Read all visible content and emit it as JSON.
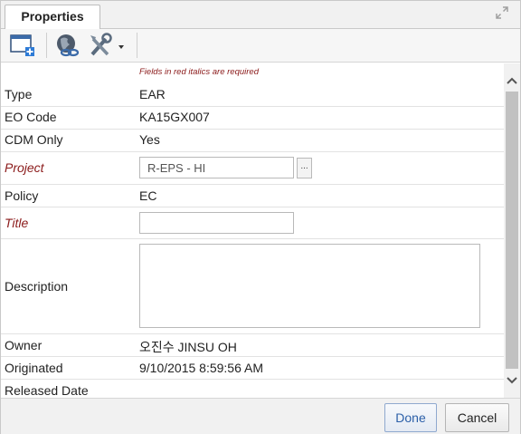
{
  "tab": {
    "label": "Properties"
  },
  "toolbar": {
    "buttons": [
      {
        "icon": "new-window-icon"
      },
      {
        "icon": "globe-link-icon"
      },
      {
        "icon": "tools-icon"
      }
    ]
  },
  "form": {
    "required_note": "Fields in red italics are required",
    "fields": {
      "type": {
        "label": "Type",
        "value": "EAR"
      },
      "eo_code": {
        "label": "EO Code",
        "value": "KA15GX007"
      },
      "cdm_only": {
        "label": "CDM Only",
        "value": "Yes"
      },
      "project": {
        "label": "Project",
        "value": "R-EPS - HI",
        "browse": "..."
      },
      "policy": {
        "label": "Policy",
        "value": "EC"
      },
      "title": {
        "label": "Title",
        "value": ""
      },
      "description": {
        "label": "Description",
        "value": ""
      },
      "owner": {
        "label": "Owner",
        "value": "오진수 JINSU OH"
      },
      "originated": {
        "label": "Originated",
        "value": "9/10/2015 8:59:56 AM"
      },
      "released_date": {
        "label": "Released Date",
        "value": ""
      }
    }
  },
  "footer": {
    "done_label": "Done",
    "cancel_label": "Cancel"
  },
  "colors": {
    "required": "#8b1a1a",
    "primary_button_text": "#2b5fa8"
  }
}
